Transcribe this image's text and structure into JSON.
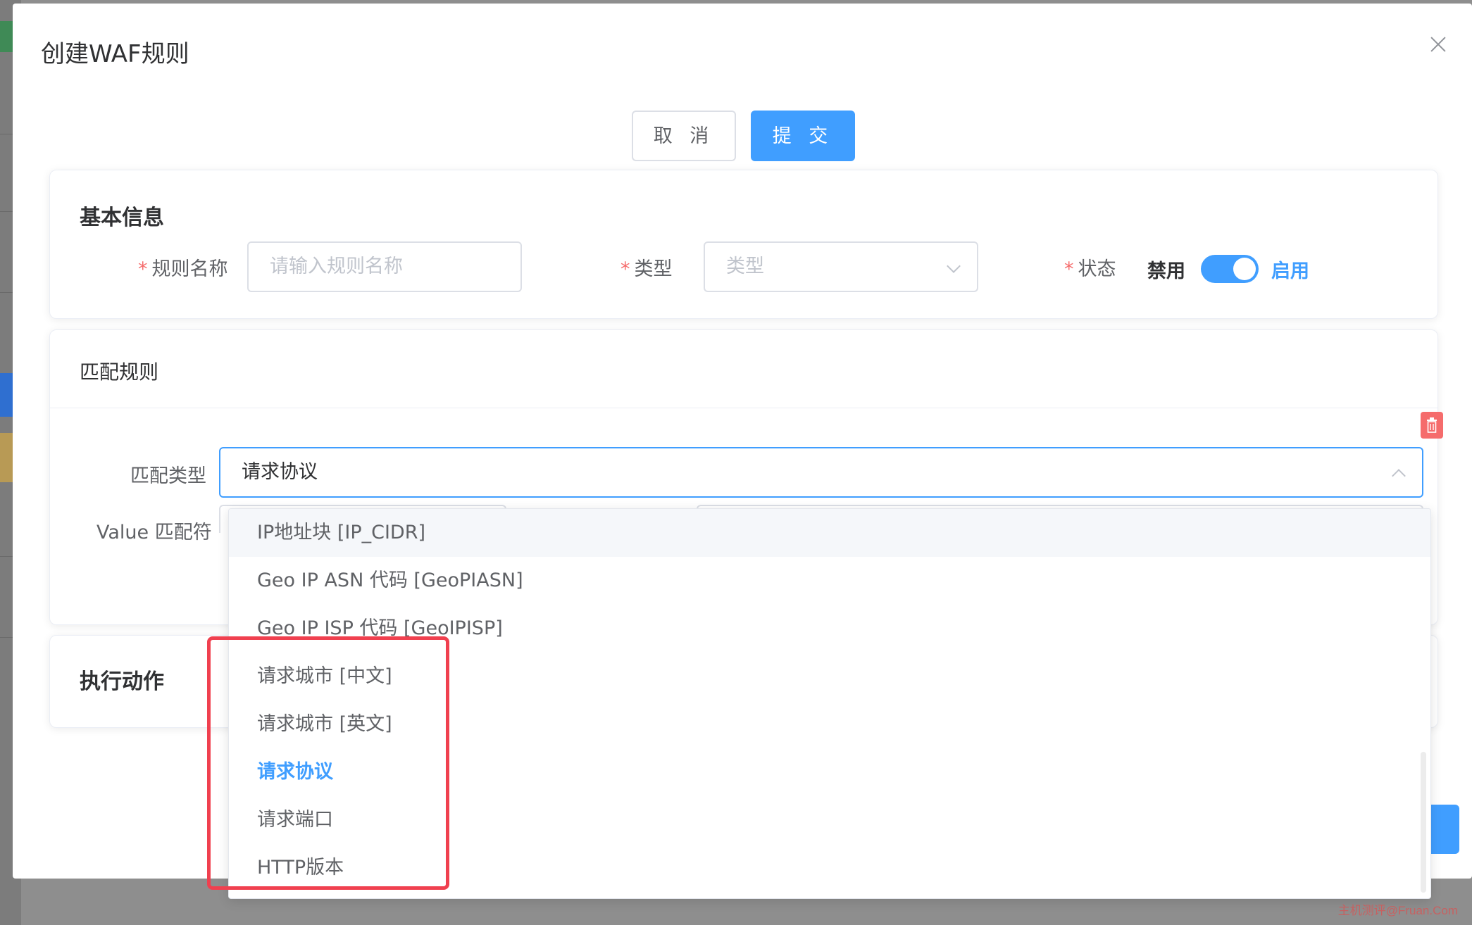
{
  "modal": {
    "title": "创建WAF规则",
    "cancel_label": "取 消",
    "submit_label": "提 交"
  },
  "basic": {
    "section_title": "基本信息",
    "required_mark": "*",
    "rule_name_label": "规则名称",
    "rule_name_placeholder": "请输入规则名称",
    "type_label": "类型",
    "type_placeholder": "类型",
    "status_label": "状态",
    "status_off_label": "禁用",
    "status_on_label": "启用",
    "status_enabled": true
  },
  "match": {
    "section_title": "匹配规则",
    "match_type_label": "匹配类型",
    "match_type_value": "请求协议",
    "value_matcher_label": "Value 匹配符"
  },
  "action": {
    "section_title": "执行动作"
  },
  "dropdown": {
    "options": [
      {
        "label": "IP地址块 [IP_CIDR]"
      },
      {
        "label": "Geo IP ASN 代码 [GeoPIASN]"
      },
      {
        "label": "Geo IP ISP 代码 [GeoIPISP]"
      },
      {
        "label": "请求城市 [中文]"
      },
      {
        "label": "请求城市 [英文]"
      },
      {
        "label": "请求协议"
      },
      {
        "label": "请求端口"
      },
      {
        "label": "HTTP版本"
      }
    ],
    "hovered_index": 0,
    "selected_index": 5
  },
  "watermark": "主机测评@Fruan.Com",
  "colors": {
    "primary": "#409eff",
    "danger": "#f56c6c",
    "highlight": "#f0404f"
  }
}
